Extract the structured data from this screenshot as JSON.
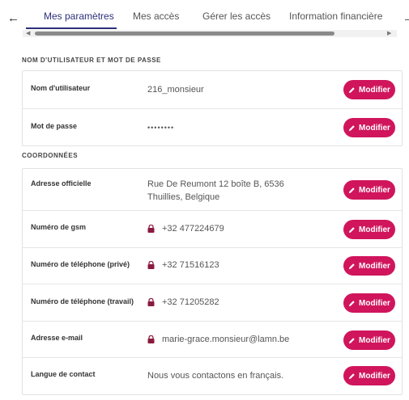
{
  "nav": {
    "left_arrow": "←",
    "right_arrow": "→",
    "tabs": [
      {
        "label": "Mes paramètres",
        "active": true
      },
      {
        "label": "Mes accès"
      },
      {
        "label": "Gérer les accès"
      },
      {
        "label": "Information financière"
      }
    ]
  },
  "sections": {
    "credentials_title": "NOM D'UTILISATEUR ET MOT DE PASSE",
    "contact_title": "COORDONNÉES"
  },
  "credentials": [
    {
      "label": "Nom d'utilisateur",
      "value": "216_monsieur"
    },
    {
      "label": "Mot de passe",
      "value": "••••••••"
    }
  ],
  "contact": [
    {
      "label": "Adresse officielle",
      "value": "Rue De Reumont 12 boîte B, 6536 Thuillies, Belgique",
      "locked": false
    },
    {
      "label": "Numéro de gsm",
      "value": "+32 477224679",
      "locked": true
    },
    {
      "label": "Numéro de téléphone (privé)",
      "value": "+32 71516123",
      "locked": true
    },
    {
      "label": "Numéro de téléphone (travail)",
      "value": "+32 71205282",
      "locked": true
    },
    {
      "label": "Adresse e-mail",
      "value": "marie-grace.monsieur@lamn.be",
      "locked": true
    },
    {
      "label": "Langue de contact",
      "value": "Nous vous contactons en français.",
      "locked": false
    }
  ],
  "button_label": "Modifier",
  "colors": {
    "accent": "#d0155c",
    "tab_active": "#2d2f7a"
  }
}
